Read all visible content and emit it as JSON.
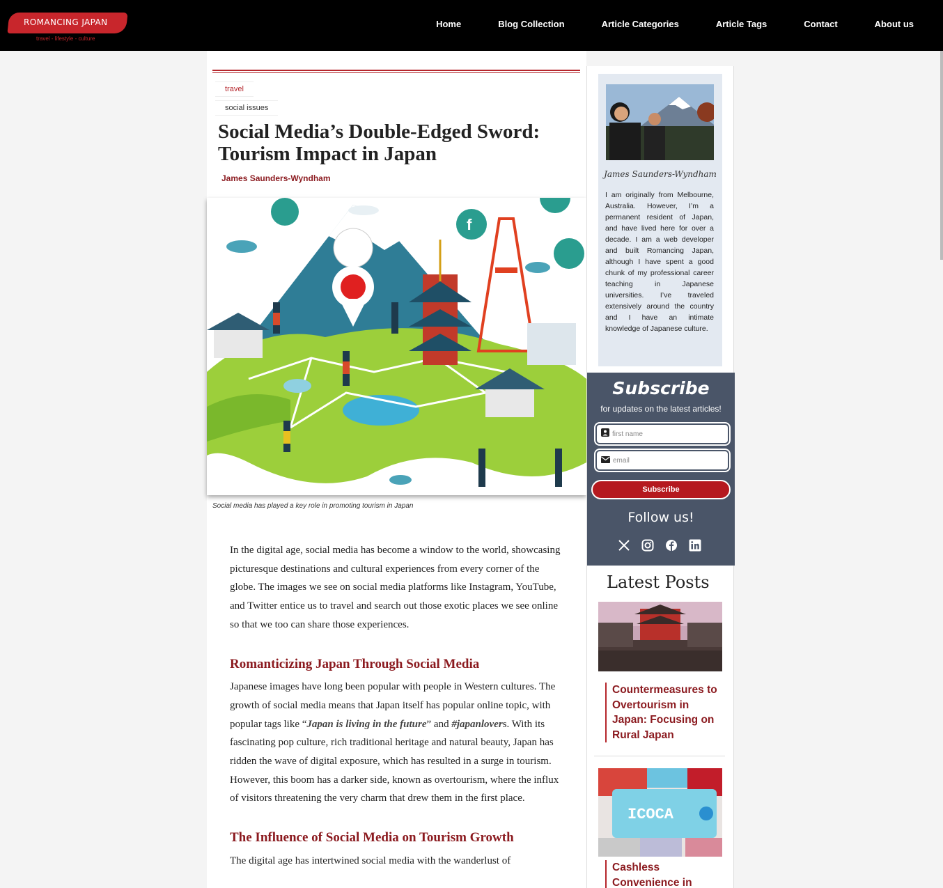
{
  "header": {
    "logo_title": "ROMANCING JAPAN",
    "logo_tagline": "travel - lifestyle - culture",
    "nav": [
      "Home",
      "Blog Collection",
      "Article Categories",
      "Article Tags",
      "Contact",
      "About us"
    ]
  },
  "article": {
    "tags": [
      "travel",
      "social issues"
    ],
    "title": "Social Media’s Double-Edged Sword: Tourism Impact in Japan",
    "author": "James Saunders-Wyndham",
    "image_caption": "Social media has played a key role in promoting tourism in Japan",
    "intro": "In the digital age, social media has become a window to the world, showcasing picturesque destinations and cultural experiences from every corner of the globe. The images we see on social media platforms like Instagram, YouTube, and Twitter entice us to travel and search out those exotic places we see online so that we too can share those experiences.",
    "section1": {
      "heading": "Romanticizing Japan Through Social Media",
      "text_a": "Japanese images have long been popular with people in Western cultures. The growth of social media means that Japan itself has popular online topic, with popular tags like “",
      "em1": "Japan is living in the future",
      "text_b": "” and ",
      "em2": "#japanlover",
      "text_c": "s. With its fascinating pop culture, rich traditional heritage and natural beauty, Japan has ridden the wave of digital exposure, which has resulted in a surge in tourism. However, this boom has a darker side, known as overtourism, where the influx of visitors threatening the very charm that drew them in the first place."
    },
    "section2": {
      "heading": "The Influence of Social Media on Tourism Growth",
      "text": "The digital age has intertwined social media with the wanderlust of"
    }
  },
  "sidebar": {
    "bio_name": "James Saunders-Wyndham",
    "bio_text": "I am originally from Melbourne, Australia. However, I’m a permanent resident of Japan, and have lived here for over a decade. I am a web developer and built Romancing Japan, although I have spent a good chunk of my professional career teaching in Japanese universities. I’ve traveled extensively around the country and I have an intimate knowledge of Japanese culture.",
    "subscribe": {
      "title": "Subscribe",
      "subtitle": "for updates on the latest articles!",
      "first_name_placeholder": "first name",
      "email_placeholder": "email",
      "button": "Subscribe",
      "follow": "Follow us!",
      "socials": [
        "x-icon",
        "instagram-icon",
        "facebook-icon",
        "linkedin-icon"
      ]
    },
    "latest_title": "Latest Posts",
    "posts": [
      {
        "title": "Countermeasures to Overtourism in Japan: Focusing on Rural Japan"
      },
      {
        "title": "Cashless Convenience in"
      }
    ],
    "post2_image_text": "ICOCA"
  },
  "colors": {
    "accent": "#b5262c",
    "header_bg": "#000000",
    "subscribe_bg": "#4a5568",
    "bio_bg": "#e3e9f1"
  }
}
